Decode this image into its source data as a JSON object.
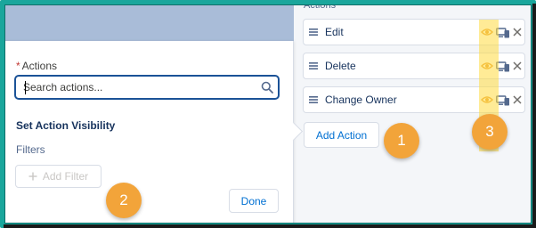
{
  "filter_panel": {
    "actions_label": "Actions",
    "required_marker": "*",
    "search_placeholder": "Search actions...",
    "set_visibility_heading": "Set Action Visibility",
    "filters_label": "Filters",
    "add_filter_label": "Add Filter",
    "done_label": "Done"
  },
  "actions_list": {
    "heading": "Actions",
    "items": [
      {
        "label": "Edit"
      },
      {
        "label": "Delete"
      },
      {
        "label": "Change Owner"
      }
    ],
    "add_action_label": "Add Action"
  },
  "callouts": [
    "1",
    "2",
    "3"
  ],
  "colors": {
    "frame": "#1aa69c",
    "brand_blue": "#0070d2",
    "callout_orange": "#f2a43a",
    "highlight_yellow": "#ffdb40",
    "eye_icon_orange": "#e8a33d"
  }
}
